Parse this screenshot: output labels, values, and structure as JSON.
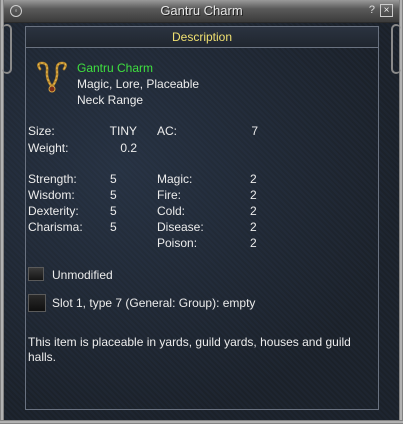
{
  "window": {
    "title": "Gantru Charm",
    "help_label": "?",
    "close_label": "×"
  },
  "panel": {
    "header": "Description"
  },
  "item": {
    "icon": "necklace-charm-icon",
    "name": "Gantru Charm",
    "flags": "Magic, Lore, Placeable",
    "slot": "Neck Range"
  },
  "stats": {
    "size_label": "Size:",
    "size_value": "TINY",
    "ac_label": "AC:",
    "ac_value": "7",
    "weight_label": "Weight:",
    "weight_value": "0.2",
    "strength_label": "Strength:",
    "strength_value": "5",
    "wisdom_label": "Wisdom:",
    "wisdom_value": "5",
    "dexterity_label": "Dexterity:",
    "dexterity_value": "5",
    "charisma_label": "Charisma:",
    "charisma_value": "5",
    "magic_label": "Magic:",
    "magic_value": "2",
    "fire_label": "Fire:",
    "fire_value": "2",
    "cold_label": "Cold:",
    "cold_value": "2",
    "disease_label": "Disease:",
    "disease_value": "2",
    "poison_label": "Poison:",
    "poison_value": "2"
  },
  "modifiers": {
    "unmodified_label": "Unmodified",
    "slot_label": "Slot 1, type 7 (General: Group): empty"
  },
  "note": "This item is placeable in yards, guild yards, houses and guild halls.",
  "colors": {
    "name_green": "#3fe03f",
    "header_yellow": "#f0e070"
  }
}
